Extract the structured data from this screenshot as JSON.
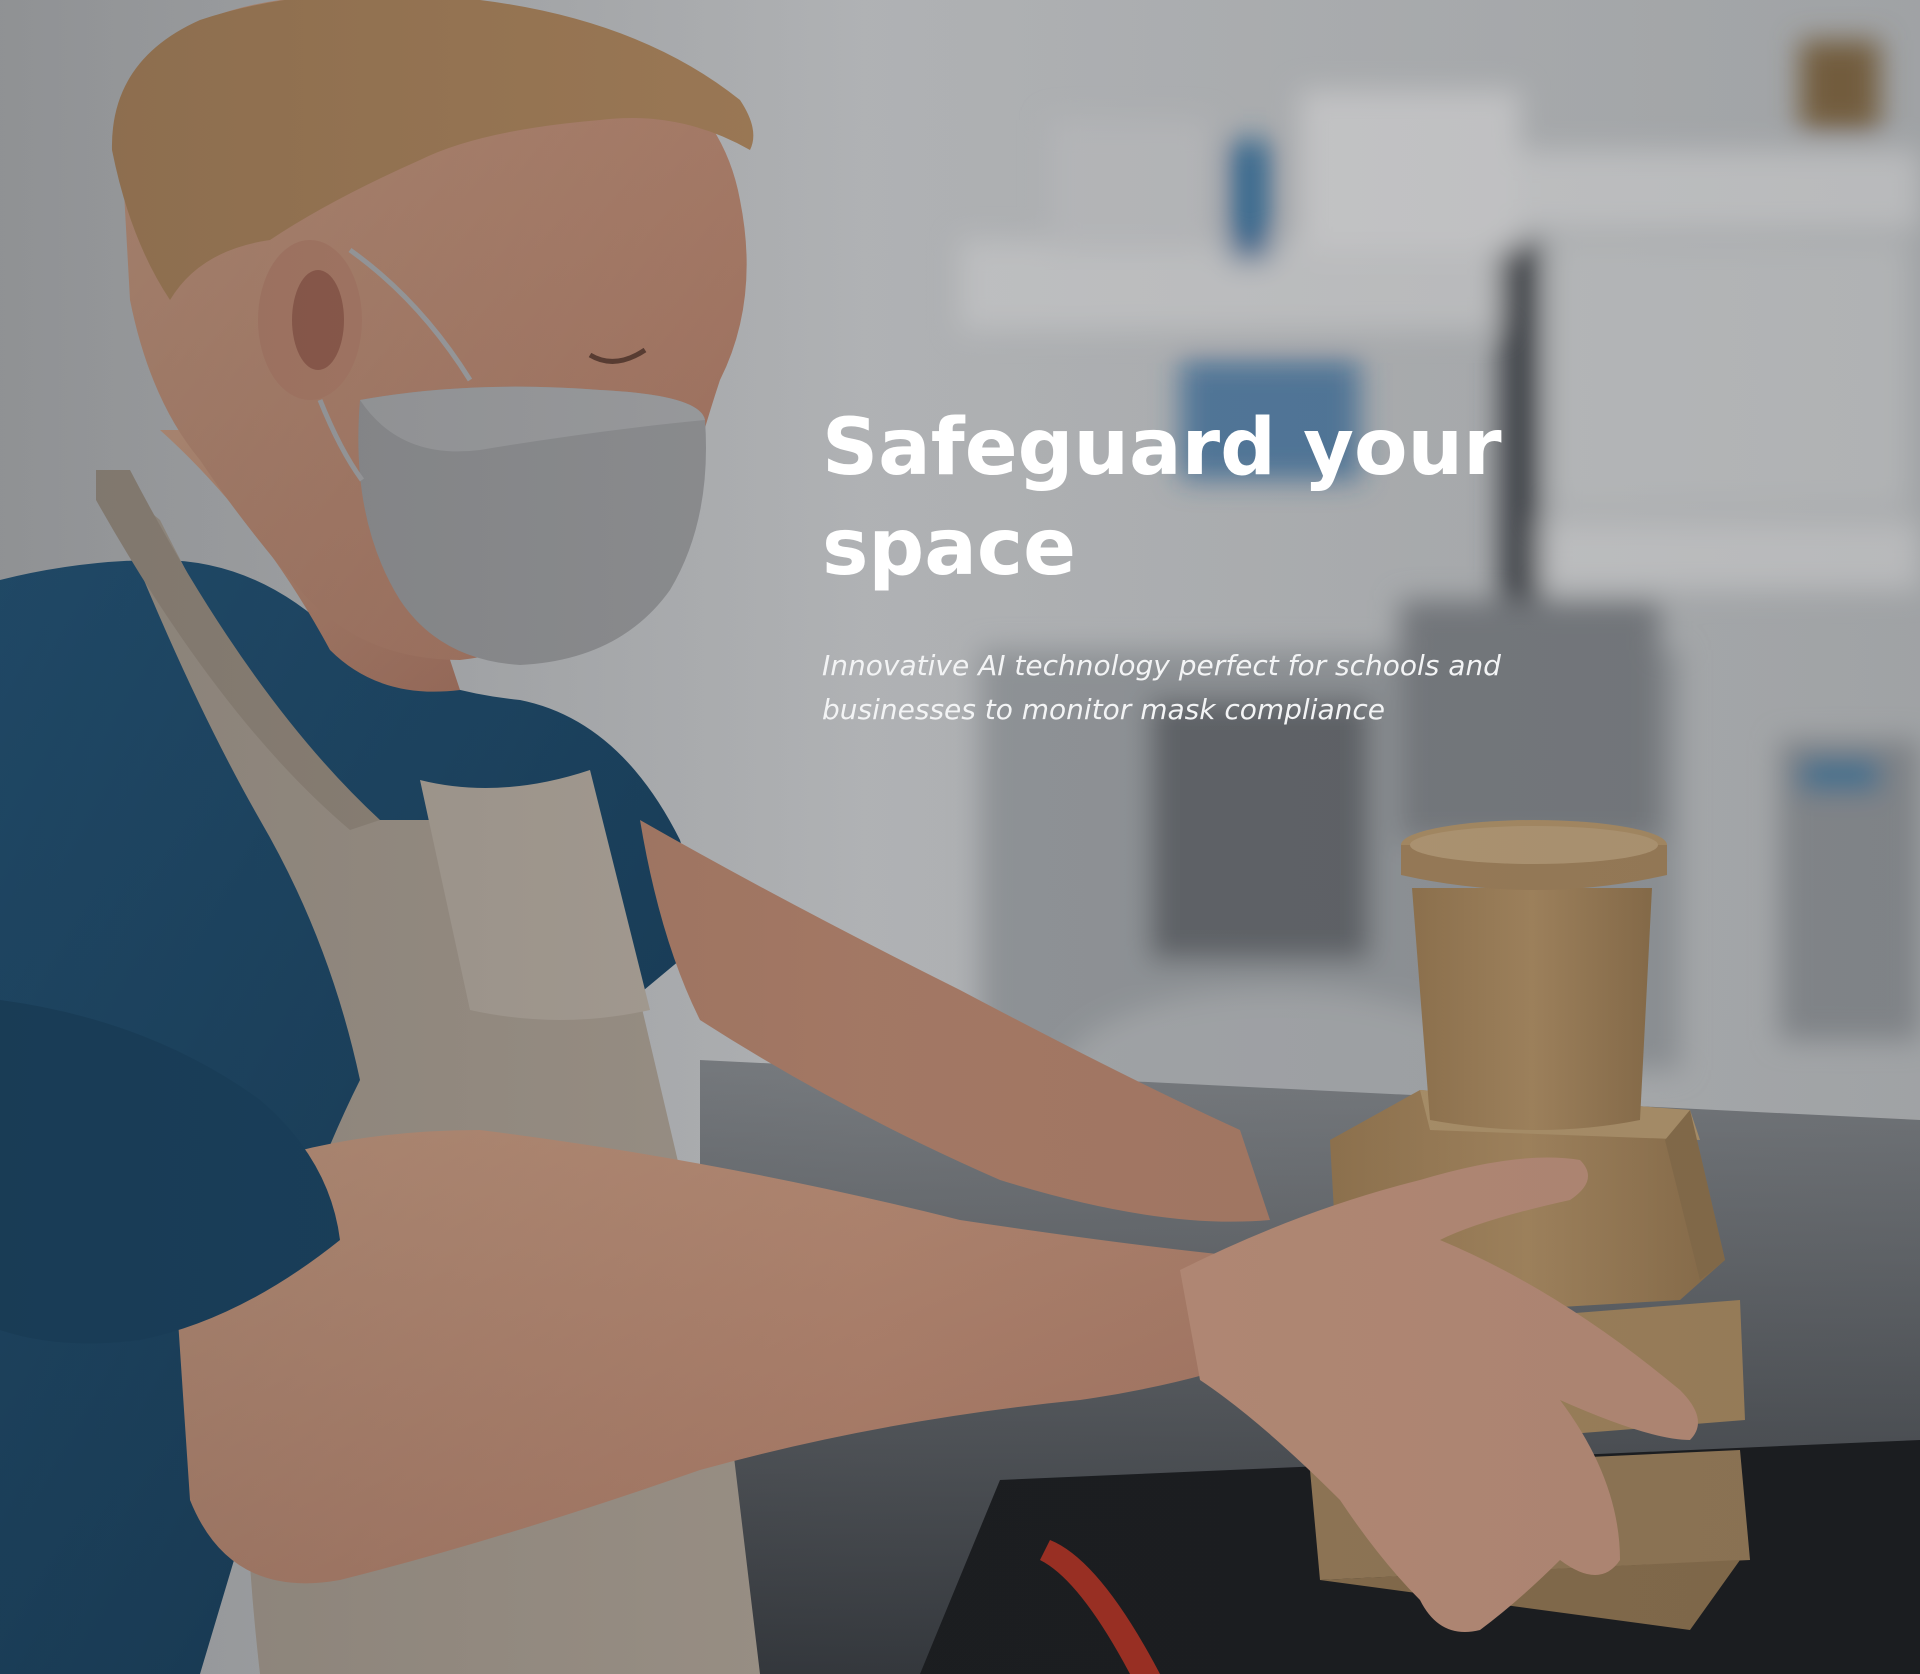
{
  "hero": {
    "title": "Safeguard your space",
    "subtitle": "Innovative AI technology perfect for schools and businesses to monitor mask compliance",
    "background_image": "photo of a masked food worker in a blue t-shirt and beige apron stacking kraft paper takeaway containers in a kitchen",
    "overlay_color": "#1a1c20"
  },
  "colors": {
    "title_text": "#ffffff",
    "subtitle_text": "#f3f4f5",
    "shirt_blue": "#1e4f73",
    "apron_beige": "#b9ad9f",
    "mask_gray": "#a7a8aa",
    "kraft_paper": "#b08f62",
    "background_kitchen": "#cfd1d3"
  }
}
